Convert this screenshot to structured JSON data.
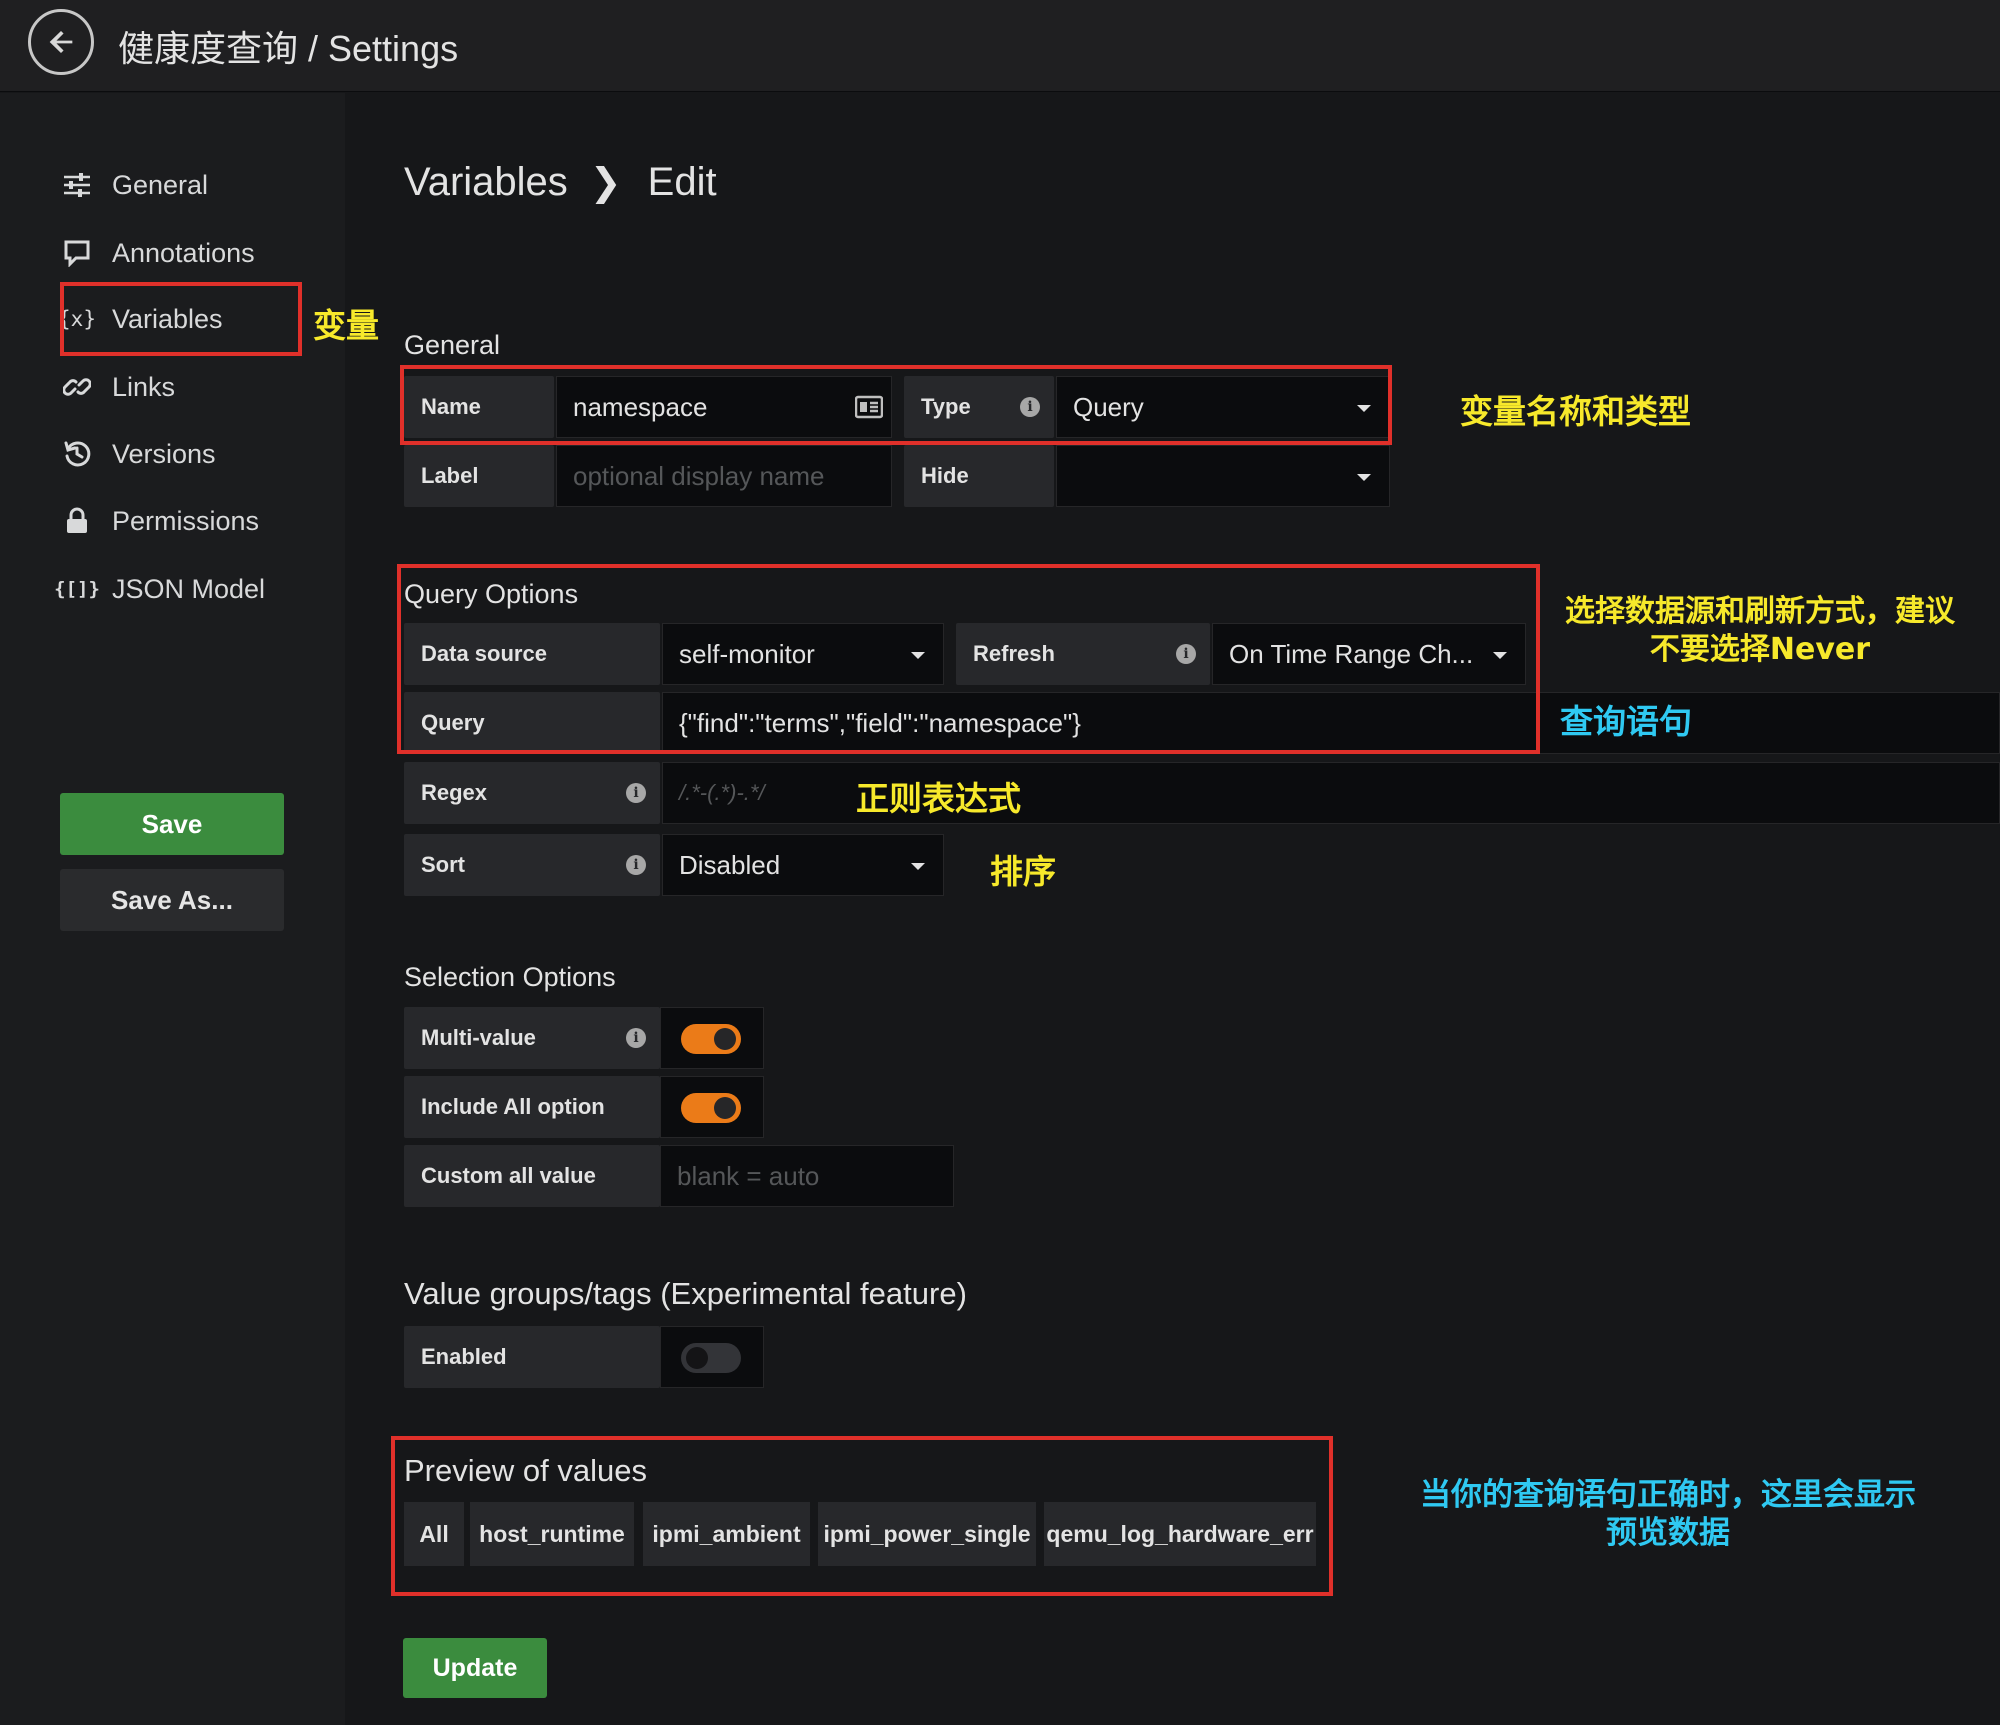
{
  "topbar": {
    "title": "健康度查询 / Settings"
  },
  "sidebar": {
    "items": [
      {
        "label": "General",
        "icon": "sliders-icon"
      },
      {
        "label": "Annotations",
        "icon": "comment-icon"
      },
      {
        "label": "Variables",
        "icon": "variable-icon"
      },
      {
        "label": "Links",
        "icon": "link-icon"
      },
      {
        "label": "Versions",
        "icon": "history-icon"
      },
      {
        "label": "Permissions",
        "icon": "lock-icon"
      },
      {
        "label": "JSON Model",
        "icon": "json-icon"
      }
    ],
    "save_label": "Save",
    "save_as_label": "Save As..."
  },
  "breadcrumb": {
    "parent": "Variables",
    "current": "Edit"
  },
  "general": {
    "title": "General",
    "name_label": "Name",
    "name_value": "namespace",
    "type_label": "Type",
    "type_value": "Query",
    "label_label": "Label",
    "label_placeholder": "optional display name",
    "hide_label": "Hide",
    "hide_value": ""
  },
  "query_options": {
    "title": "Query Options",
    "datasource_label": "Data source",
    "datasource_value": "self-monitor",
    "refresh_label": "Refresh",
    "refresh_value": "On Time Range Ch...",
    "query_label": "Query",
    "query_value": "{\"find\":\"terms\",\"field\":\"namespace\"}",
    "regex_label": "Regex",
    "regex_placeholder": "/.*-(.*)-.*/",
    "sort_label": "Sort",
    "sort_value": "Disabled"
  },
  "selection_options": {
    "title": "Selection Options",
    "multi_value_label": "Multi-value",
    "multi_value_on": true,
    "include_all_label": "Include All option",
    "include_all_on": true,
    "custom_all_label": "Custom all value",
    "custom_all_placeholder": "blank = auto"
  },
  "value_groups": {
    "title": "Value groups/tags (Experimental feature)",
    "enabled_label": "Enabled",
    "enabled_on": false
  },
  "preview": {
    "title": "Preview of values",
    "values": [
      "All",
      "host_runtime",
      "ipmi_ambient",
      "ipmi_power_single",
      "qemu_log_hardware_err"
    ]
  },
  "update_label": "Update",
  "annotations": {
    "variables_note": "变量",
    "name_type_note": "变量名称和类型",
    "datasource_note_line1": "选择数据源和刷新方式，建议",
    "datasource_note_line2": "不要选择Never",
    "query_note": "查询语句",
    "regex_note": "正则表达式",
    "sort_note": "排序",
    "preview_note_line1": "当你的查询语句正确时，这里会显示",
    "preview_note_line2": "预览数据",
    "colors": {
      "highlight_box": "#e0302a",
      "yellow_note": "#f7e92b",
      "cyan_note": "#2fc9f2"
    }
  }
}
